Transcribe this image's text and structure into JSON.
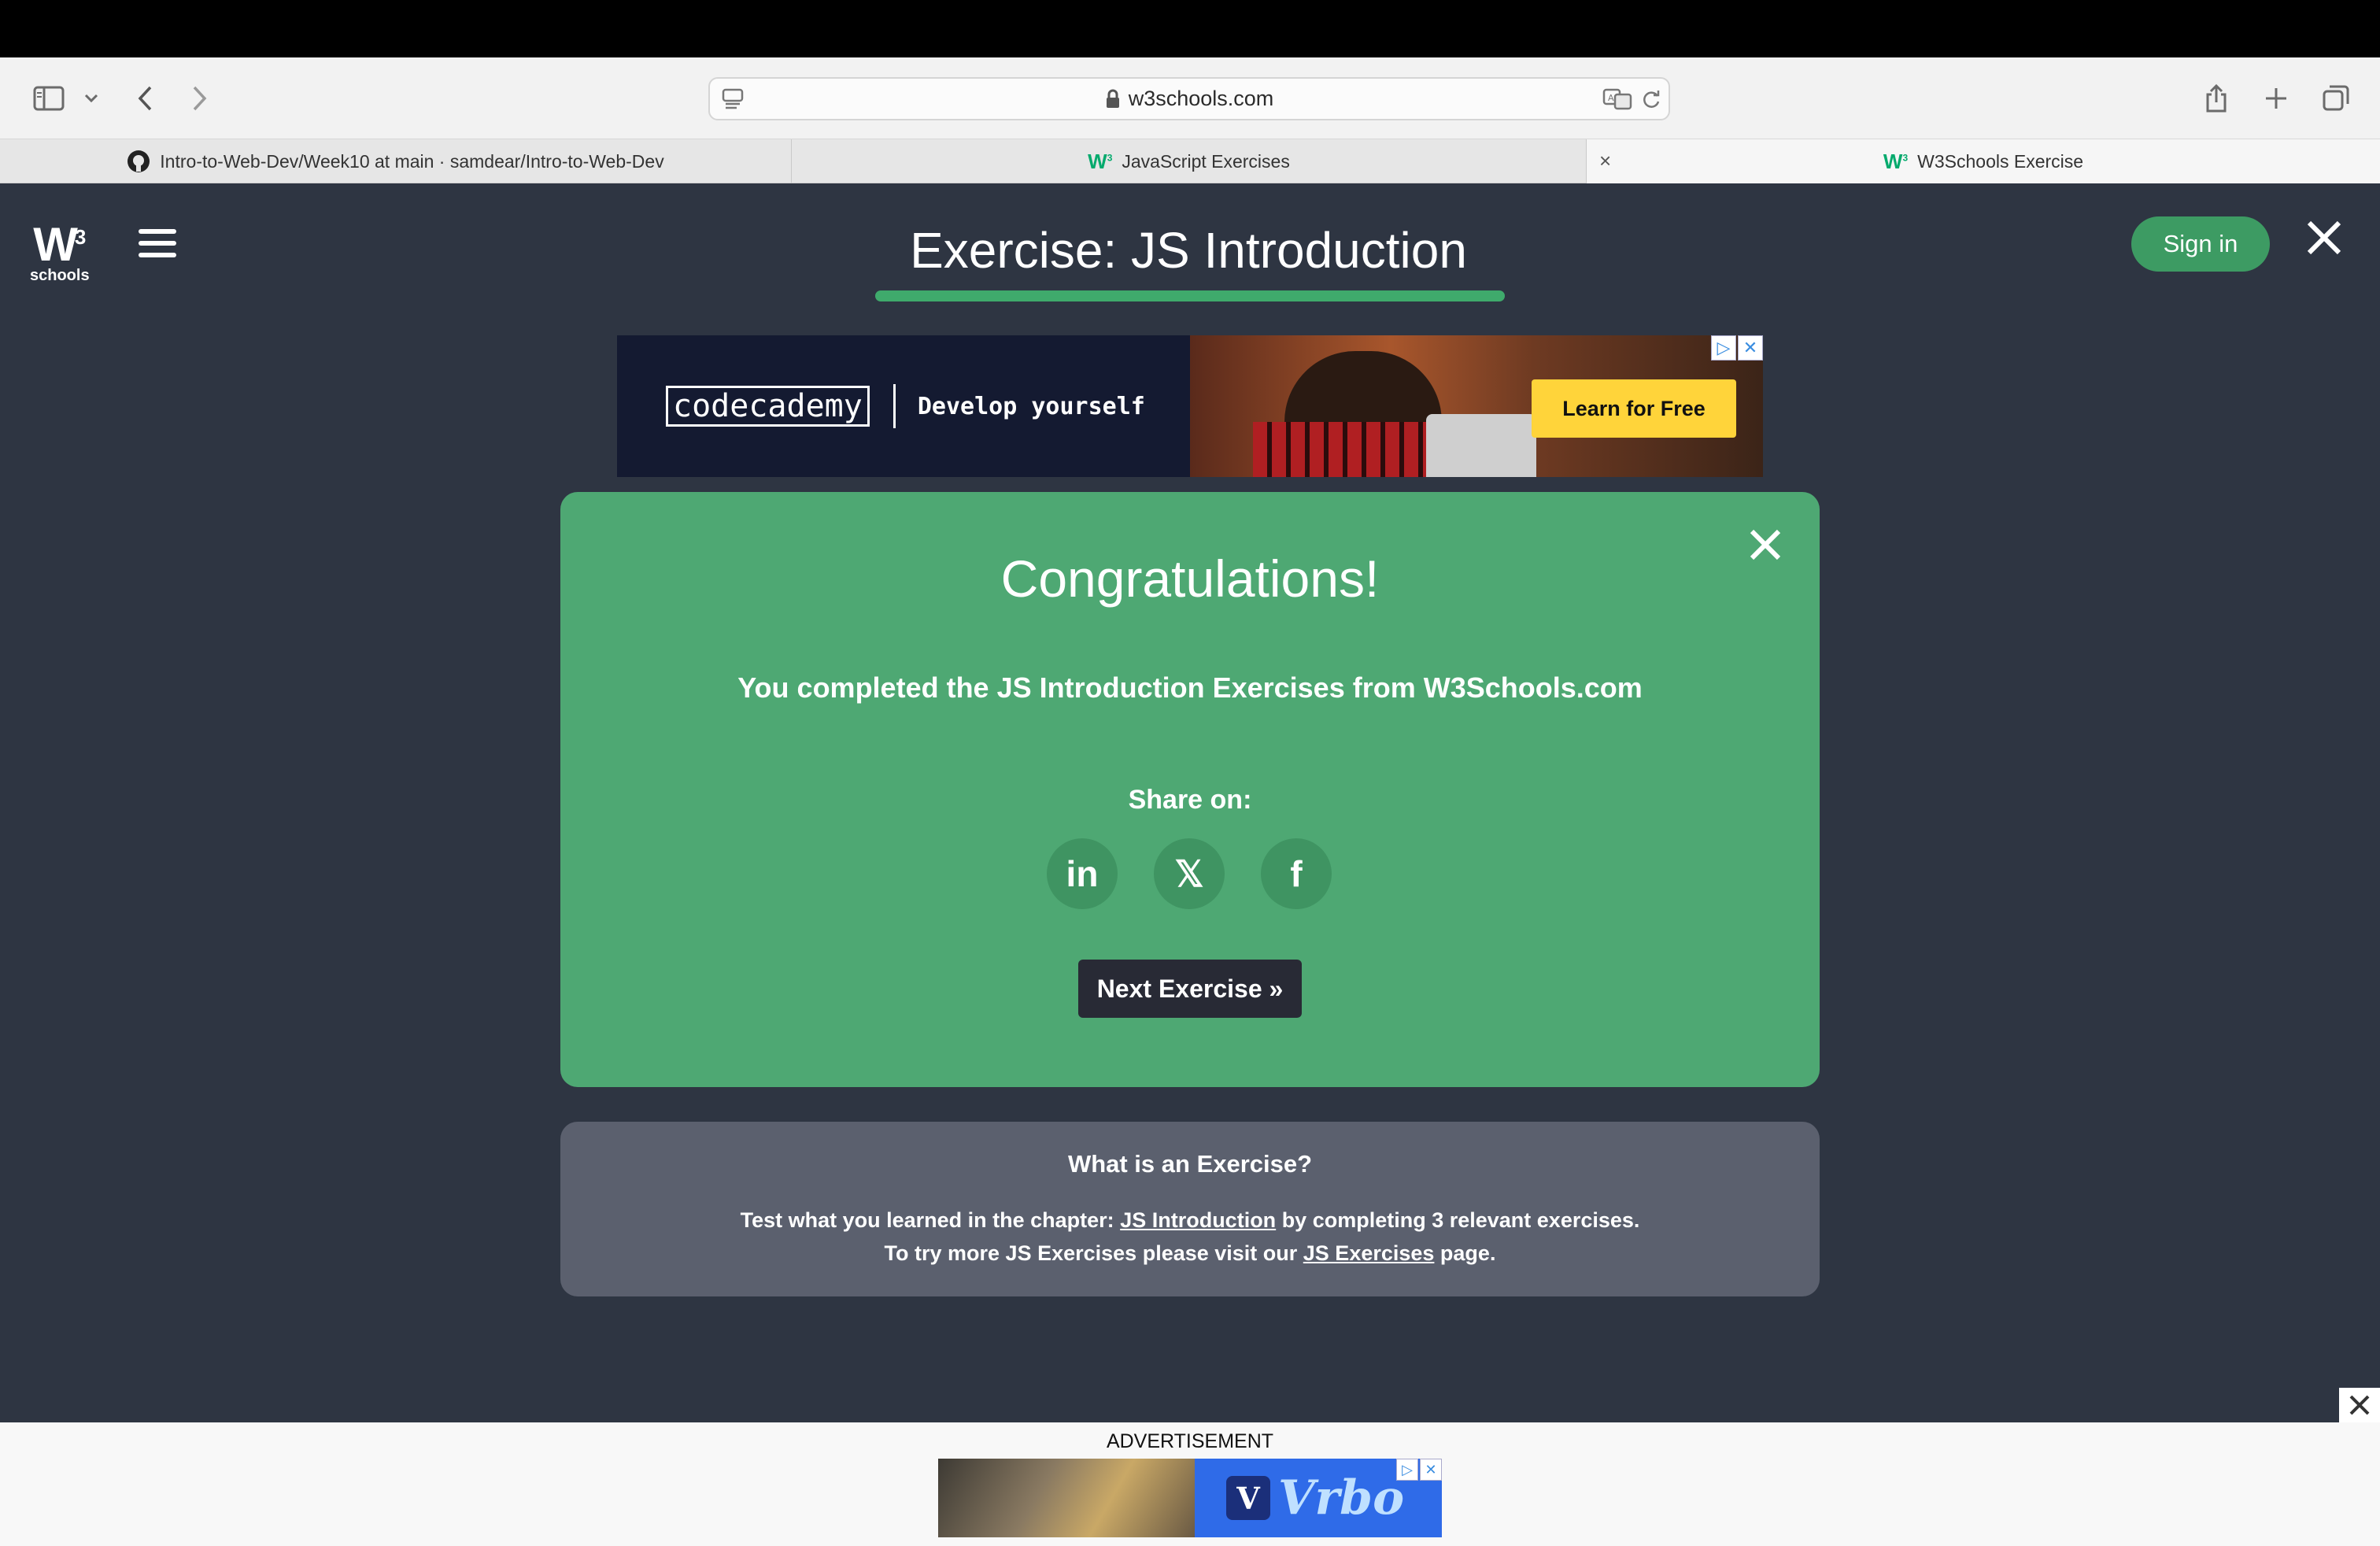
{
  "browser": {
    "url": "w3schools.com",
    "tabs": [
      {
        "label": "Intro-to-Web-Dev/Week10 at main · samdear/Intro-to-Web-Dev",
        "icon": "github-icon"
      },
      {
        "label": "JavaScript Exercises",
        "icon": "w3schools-icon"
      },
      {
        "label": "W3Schools Exercise",
        "icon": "w3schools-icon"
      }
    ]
  },
  "header": {
    "logo_text": "schools",
    "logo_sup": "3",
    "title": "Exercise: JS Introduction",
    "signin_label": "Sign in"
  },
  "ad_top": {
    "brand": "codecademy",
    "tagline": "Develop yourself",
    "cta": "Learn for Free"
  },
  "modal": {
    "title": "Congratulations!",
    "subtitle": "You completed the JS Introduction Exercises from W3Schools.com",
    "share_label": "Share on:",
    "social": [
      {
        "name": "linkedin-icon",
        "glyph": "in"
      },
      {
        "name": "x-icon",
        "glyph": "𝕏"
      },
      {
        "name": "facebook-icon",
        "glyph": "f"
      }
    ],
    "next_label": "Next Exercise »"
  },
  "info": {
    "heading": "What is an Exercise?",
    "line1_pre": "Test what you learned in the chapter: ",
    "line1_link": "JS Introduction",
    "line1_post": " by completing 3 relevant exercises.",
    "line2_pre": "To try more JS Exercises please visit our ",
    "line2_link": "JS Exercises",
    "line2_post": " page."
  },
  "ad_bottom": {
    "label": "ADVERTISEMENT",
    "brand": "Vrbo"
  },
  "colors": {
    "page_bg": "#2e3542",
    "modal_bg": "#4ea873",
    "accent": "#3faa6c",
    "info_bg": "#5b606e"
  }
}
